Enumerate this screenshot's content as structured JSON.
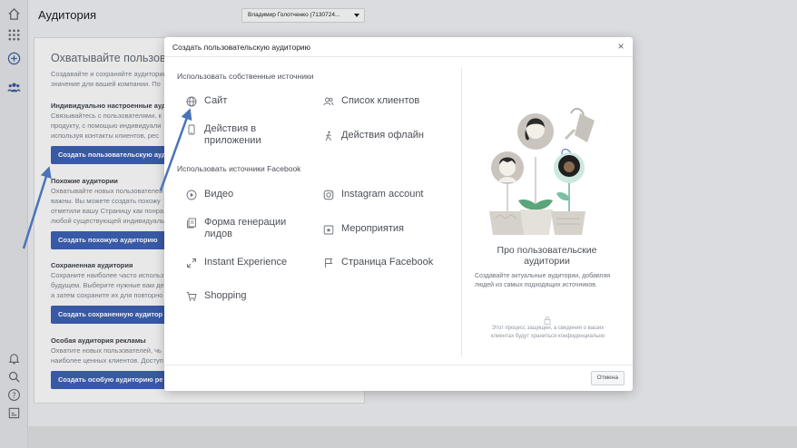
{
  "app": {
    "page_title": "Аудитория",
    "account_selector": "Владимир Голотченко (7130724..."
  },
  "rail": {
    "icons": [
      "home-icon",
      "apps-grid-icon",
      "add-icon",
      "audience-icon",
      "bell-icon",
      "search-icon",
      "help-icon",
      "report-icon"
    ]
  },
  "background_card": {
    "heading": "Охватывайте пользовате",
    "description": "Создавайте и сохраняйте аудитории значение для вашей компании. По",
    "sections": [
      {
        "title": "Индивидуально настроенные ауди",
        "lines": [
          "Связывайтесь с пользователями, к",
          "продукту, с помощью индивидуали",
          "используя контакты клиентов, pec"
        ],
        "button": "Создать пользовательскую ауди"
      },
      {
        "title": "Похожие аудитории",
        "lines": [
          "Охватывайте новых пользователей",
          "важны. Вы можете создать похожу",
          "отметили вашу Страницу как понра",
          "любой существующей индивидуаль"
        ],
        "button": "Создать похожую аудиторию"
      },
      {
        "title": "Сохраненная аудитория",
        "lines": [
          "Сохраните наиболее часто использ",
          "будущем. Выберите нужные вам де",
          "а затем сохраните их для повторно"
        ],
        "button": "Создать сохраненную аудитор"
      },
      {
        "title": "Особая аудитория рекламы",
        "lines": [
          "Охватите новых пользователей, чь",
          "наиболее ценных клиентов. Доступ"
        ],
        "button": "Создать особую аудиторию ре"
      }
    ]
  },
  "modal": {
    "title": "Создать пользовательскую аудиторию",
    "close_label": "×",
    "group_own": "Использовать собственные источники",
    "group_facebook": "Использовать источники Facebook",
    "options_own": [
      {
        "label": "Сайт",
        "icon": "globe-icon"
      },
      {
        "label": "Список клиентов",
        "icon": "people-icon"
      },
      {
        "label": "Действия в приложении",
        "icon": "phone-icon"
      },
      {
        "label": "Действия офлайн",
        "icon": "person-walk-icon"
      }
    ],
    "options_facebook": [
      {
        "label": "Видео",
        "icon": "play-icon"
      },
      {
        "label": "Instagram account",
        "icon": "instagram-icon"
      },
      {
        "label": "Форма генерации лидов",
        "icon": "form-icon"
      },
      {
        "label": "Мероприятия",
        "icon": "calendar-star-icon"
      },
      {
        "label": "Instant Experience",
        "icon": "expand-icon"
      },
      {
        "label": "Страница Facebook",
        "icon": "flag-icon"
      },
      {
        "label": "Shopping",
        "icon": "cart-icon"
      }
    ],
    "about": {
      "heading": "Про пользовательские аудитории",
      "description": "Создавайте актуальные аудитории, добавляя людей из самых подходящих источников.",
      "privacy": "Этот процесс защищен, а сведения о ваших клиентах будут храниться конфиденциально"
    },
    "cancel_label": "Отмена"
  },
  "colors": {
    "primary_button": "#3c5fb0",
    "arrow": "#4a74b8"
  }
}
